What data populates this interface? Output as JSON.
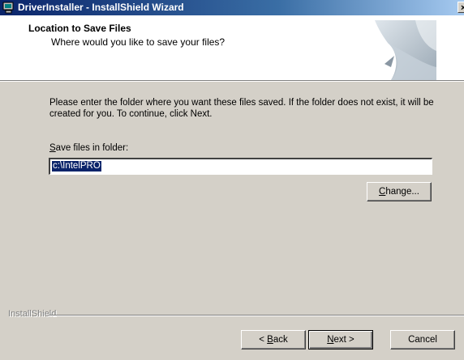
{
  "window": {
    "title": "DriverInstaller - InstallShield Wizard",
    "close_glyph": "×",
    "icon": "installer-computer-icon"
  },
  "header": {
    "title": "Location to Save Files",
    "subtitle": "Where would you like to save your files?",
    "graphic": "installshield-page-graphic"
  },
  "body": {
    "intro": "Please enter the folder where you want these files saved.  If the folder does not exist, it will be created for you.   To continue, click Next.",
    "field_label_accel": "S",
    "field_label_rest": "ave files in folder:",
    "path_value": "c:\\IntelPRO"
  },
  "buttons": {
    "change_accel": "C",
    "change_rest": "hange...",
    "back_prefix": "< ",
    "back_accel": "B",
    "back_rest": "ack",
    "next_accel": "N",
    "next_rest": "ext >",
    "cancel": "Cancel"
  },
  "footer": {
    "brand": "InstallShield"
  },
  "colors": {
    "dialog_bg": "#d4d0c8",
    "title_start": "#0a246a",
    "title_end": "#a6caf0",
    "selection": "#0a246a"
  }
}
